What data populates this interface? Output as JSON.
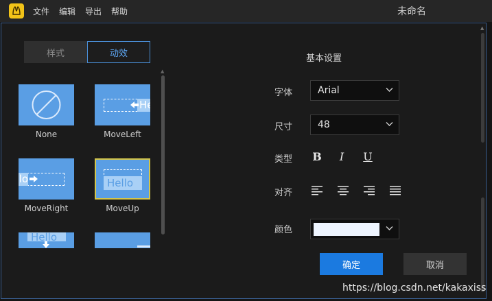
{
  "app": {
    "menu": [
      "文件",
      "编辑",
      "导出",
      "帮助"
    ],
    "window_title": "未命名"
  },
  "tabs": {
    "style": "样式",
    "animation": "动效",
    "active": "animation"
  },
  "animations": [
    {
      "name": "None",
      "selected": false
    },
    {
      "name": "MoveLeft",
      "selected": false
    },
    {
      "name": "MoveRight",
      "selected": false
    },
    {
      "name": "MoveUp",
      "selected": true
    },
    {
      "name": "",
      "selected": false
    },
    {
      "name": "",
      "selected": false
    }
  ],
  "preview_text": "Hello",
  "settings": {
    "title": "基本设置",
    "font_label": "字体",
    "font_value": "Arial",
    "size_label": "尺寸",
    "size_value": "48",
    "type_label": "类型",
    "type_buttons": [
      "B",
      "I",
      "U"
    ],
    "align_label": "对齐",
    "align_icons": [
      "align-left-icon",
      "align-center-icon",
      "align-right-icon",
      "align-justify-icon"
    ],
    "color_label": "颜色",
    "color_value": "#eef5ff"
  },
  "buttons": {
    "ok": "确定",
    "cancel": "取消"
  },
  "watermark": "https://blog.csdn.net/kakaxiss",
  "colors": {
    "accent": "#1b7ae0",
    "thumb_bg": "#5a9ee4",
    "selected_outline": "#d4c64a"
  }
}
